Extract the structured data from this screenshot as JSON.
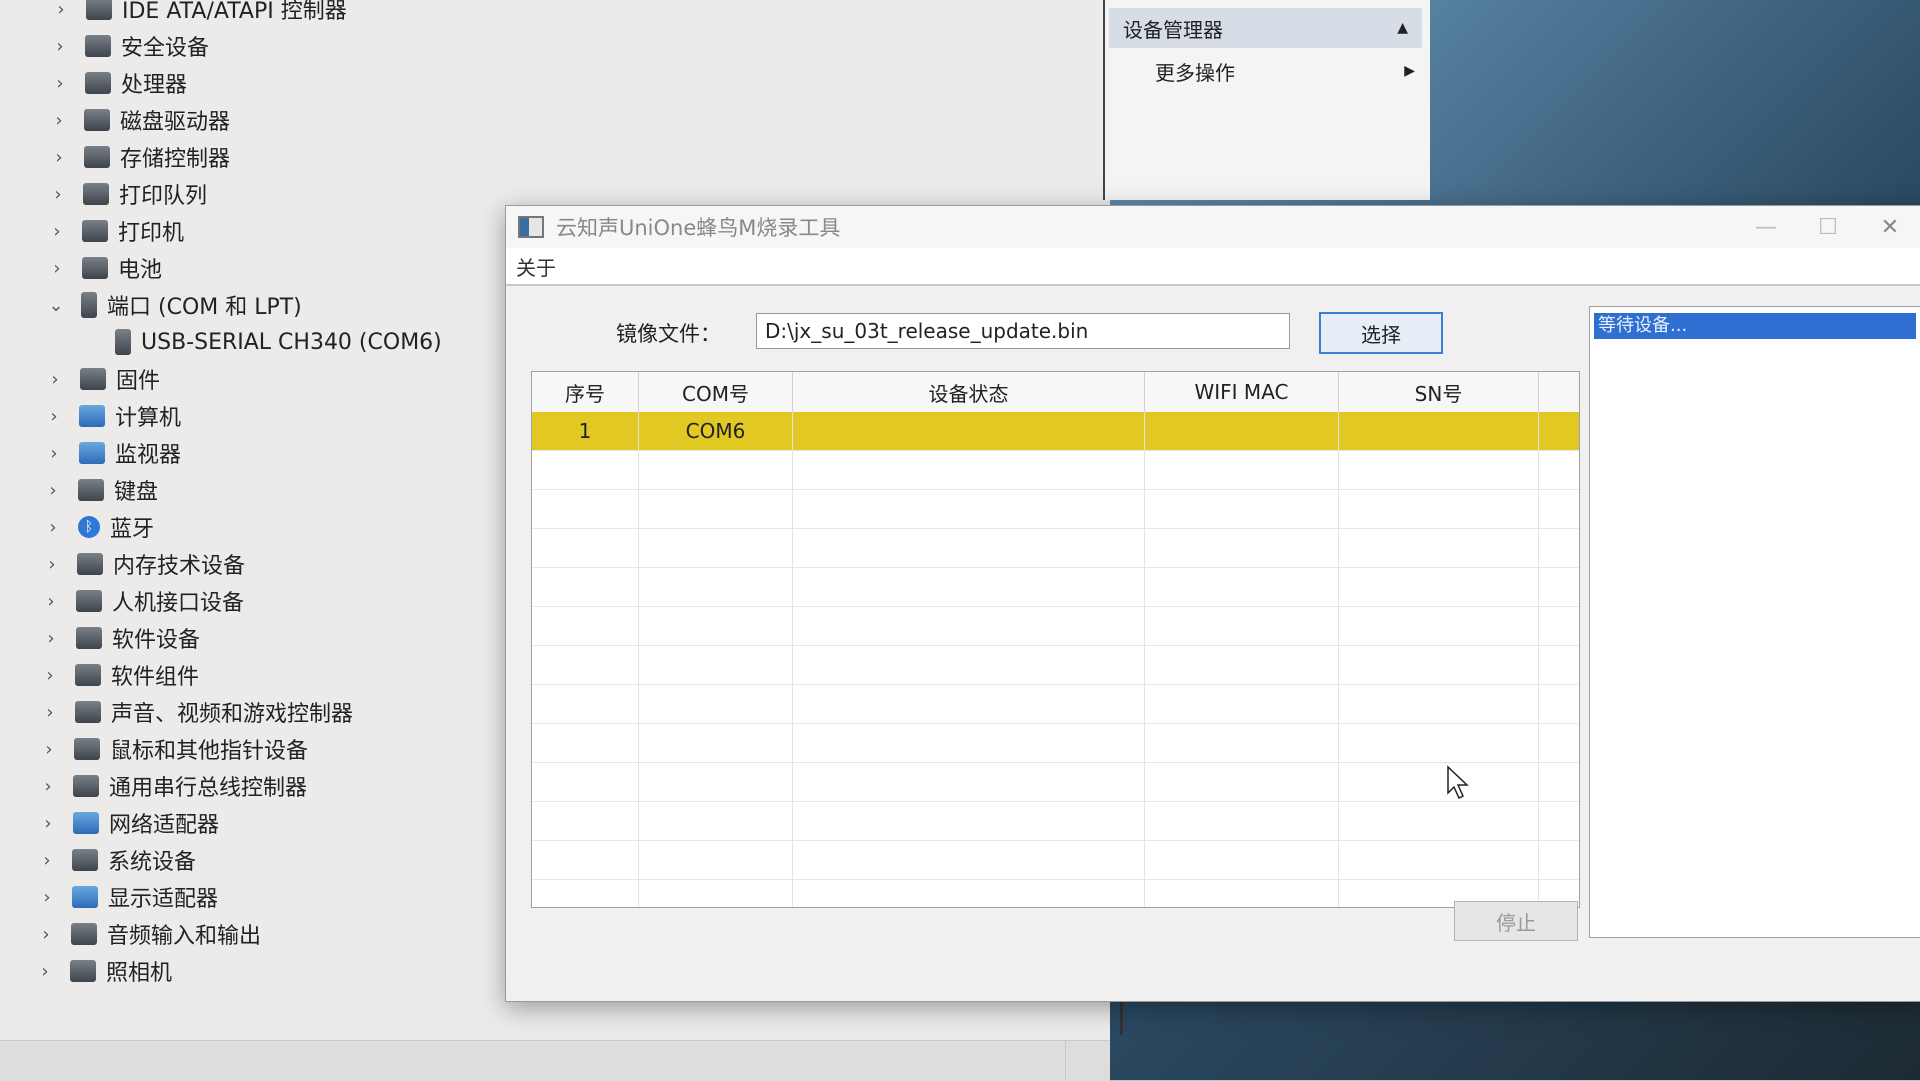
{
  "device_manager": {
    "tree": [
      {
        "label": "IDE ATA/ATAPI 控制器",
        "expanded": false
      },
      {
        "label": "安全设备",
        "expanded": false
      },
      {
        "label": "处理器",
        "expanded": false
      },
      {
        "label": "磁盘驱动器",
        "expanded": false
      },
      {
        "label": "存储控制器",
        "expanded": false
      },
      {
        "label": "打印队列",
        "expanded": false
      },
      {
        "label": "打印机",
        "expanded": false
      },
      {
        "label": "电池",
        "expanded": false
      },
      {
        "label": "端口 (COM 和 LPT)",
        "expanded": true
      },
      {
        "label": "USB-SERIAL CH340 (COM6)",
        "child": true
      },
      {
        "label": "固件",
        "expanded": false
      },
      {
        "label": "计算机",
        "expanded": false
      },
      {
        "label": "监视器",
        "expanded": false
      },
      {
        "label": "键盘",
        "expanded": false
      },
      {
        "label": "蓝牙",
        "expanded": false
      },
      {
        "label": "内存技术设备",
        "expanded": false
      },
      {
        "label": "人机接口设备",
        "expanded": false
      },
      {
        "label": "软件设备",
        "expanded": false
      },
      {
        "label": "软件组件",
        "expanded": false
      },
      {
        "label": "声音、视频和游戏控制器",
        "expanded": false
      },
      {
        "label": "鼠标和其他指针设备",
        "expanded": false
      },
      {
        "label": "通用串行总线控制器",
        "expanded": false
      },
      {
        "label": "网络适配器",
        "expanded": false
      },
      {
        "label": "系统设备",
        "expanded": false
      },
      {
        "label": "显示适配器",
        "expanded": false
      },
      {
        "label": "音频输入和输出",
        "expanded": false
      },
      {
        "label": "照相机",
        "expanded": false
      }
    ],
    "actions": {
      "header": "设备管理器",
      "more": "更多操作"
    }
  },
  "tool": {
    "title": "云知声UniOne蜂鸟M烧录工具",
    "menu": [
      "关于"
    ],
    "file_label": "镜像文件：",
    "file_value": "D:\\jx_su_03t_release_update.bin",
    "choose_label": "选择",
    "stop_label": "停止",
    "log_line": "等待设备...",
    "table": {
      "headers": [
        "序号",
        "COM号",
        "设备状态",
        "WIFI MAC",
        "SN号"
      ],
      "rows": [
        {
          "index": "1",
          "com": "COM6",
          "status": "",
          "mac": "",
          "sn": ""
        }
      ]
    }
  },
  "colors": {
    "selected_row": "#e2c822",
    "log_highlight": "#2f6fd1",
    "choose_border": "#3c7fd1"
  }
}
